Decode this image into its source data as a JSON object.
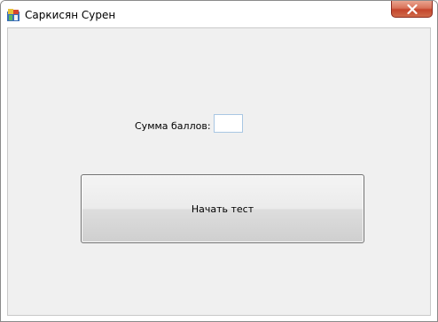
{
  "window": {
    "title": "Саркисян Сурен",
    "app_icon": "app-icon",
    "close_icon": "close-icon",
    "colors": {
      "close_button": "#c4452c",
      "client_background": "#f0f0f0"
    }
  },
  "form": {
    "score_label": "Сумма баллов:",
    "score_value": "",
    "start_button_label": "Начать тест"
  }
}
